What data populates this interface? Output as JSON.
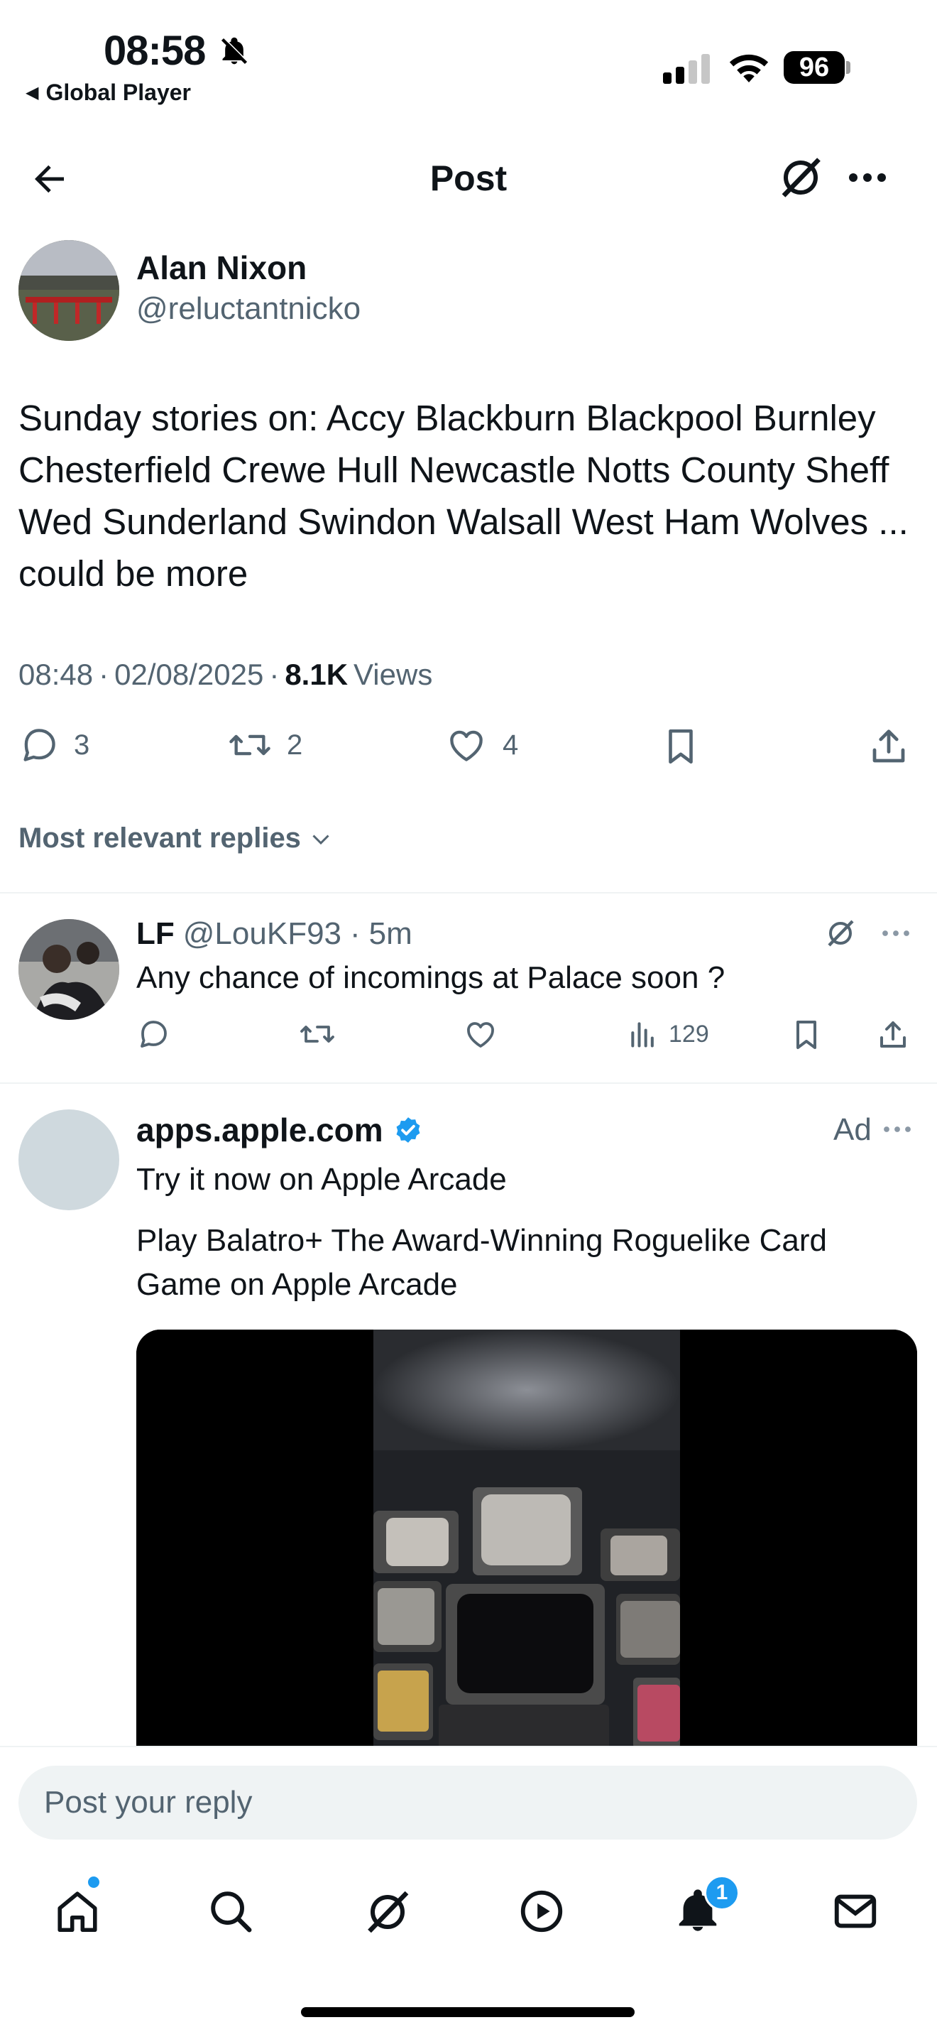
{
  "status_bar": {
    "time": "08:58",
    "back_app": "Global Player",
    "battery": "96"
  },
  "header": {
    "title": "Post"
  },
  "post": {
    "author_name": "Alan Nixon",
    "author_handle": "@reluctantnicko",
    "text": "Sunday stories on: Accy Blackburn Blackpool Burnley Chesterfield Crewe Hull Newcastle Notts County Sheff Wed Sunderland Swindon Walsall West Ham Wolves ... could be more",
    "time": "08:48",
    "date": "02/08/2025",
    "views_count": "8.1K",
    "views_label": "Views",
    "replies": "3",
    "reposts": "2",
    "likes": "4"
  },
  "replies_filter": "Most relevant replies",
  "reply": {
    "name": "LF",
    "handle": "@LouKF93",
    "age": "5m",
    "text": "Any chance of incomings at Palace soon ?",
    "views": "129"
  },
  "ad": {
    "name": "apps.apple.com",
    "label": "Ad",
    "line1": "Try it now on Apple Arcade",
    "line2": "Play Balatro+ The Award-Winning Roguelike Card Game on Apple Arcade"
  },
  "composer": {
    "placeholder": "Post your reply"
  },
  "bottom_nav": {
    "notifications_badge": "1"
  },
  "colors": {
    "accent": "#1d9bf0",
    "text_primary": "#0f1419",
    "text_secondary": "#536471"
  },
  "icons": [
    "bell-slash-icon",
    "back-arrow-icon",
    "signal-icon",
    "wifi-icon",
    "grok-icon",
    "more-icon",
    "reply-icon",
    "repost-icon",
    "like-icon",
    "bookmark-icon",
    "share-icon",
    "chevron-down-icon",
    "views-icon",
    "verified-icon",
    "home-icon",
    "search-icon",
    "grok-nav-icon",
    "video-icon",
    "notifications-icon",
    "messages-icon"
  ]
}
